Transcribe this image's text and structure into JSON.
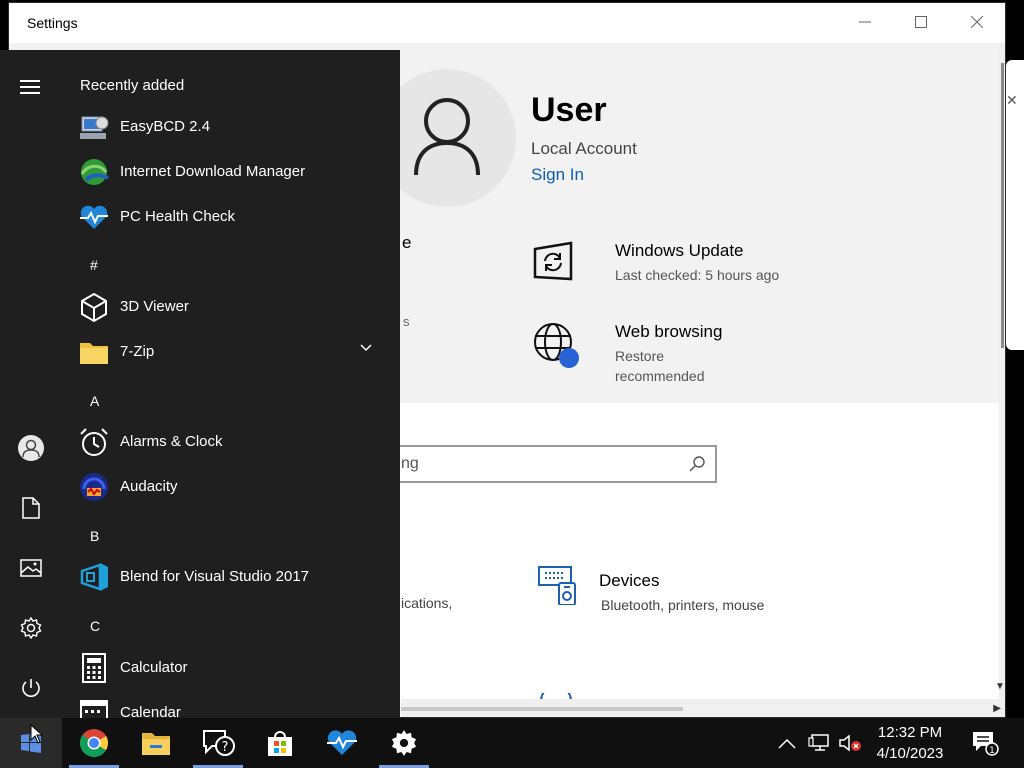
{
  "window": {
    "title": "Settings"
  },
  "user": {
    "name": "User",
    "account_type": "Local Account",
    "sign_in": "Sign In"
  },
  "hero_fragments": {
    "frag_e": "e",
    "frag_s": "s"
  },
  "status": [
    {
      "heading": "Windows Update",
      "sub": "Last checked: 5 hours ago",
      "icon": "windows-update-icon"
    },
    {
      "heading": "Web browsing",
      "sub": "Restore recommended",
      "icon": "globe-icon"
    }
  ],
  "search": {
    "value": "ng"
  },
  "devices": {
    "heading": "Devices",
    "sub": "Bluetooth, printers, mouse",
    "partial_left": "ications,"
  },
  "start_menu": {
    "section_title": "Recently added",
    "recent": [
      {
        "label": "EasyBCD 2.4",
        "icon": "easybcd-icon"
      },
      {
        "label": "Internet Download Manager",
        "icon": "idm-icon"
      },
      {
        "label": "PC Health Check",
        "icon": "pc-health-check-icon"
      }
    ],
    "letters": [
      "#",
      "A",
      "B",
      "C"
    ],
    "apps": [
      {
        "label": "3D Viewer",
        "icon": "cube-icon"
      },
      {
        "label": "7-Zip",
        "icon": "folder-icon"
      },
      {
        "label": "Alarms & Clock",
        "icon": "alarm-clock-icon"
      },
      {
        "label": "Audacity",
        "icon": "audacity-icon"
      },
      {
        "label": "Blend for Visual Studio 2017",
        "icon": "blend-icon"
      },
      {
        "label": "Calculator",
        "icon": "calculator-icon"
      },
      {
        "label": "Calendar",
        "icon": "calendar-icon"
      }
    ]
  },
  "taskbar": {
    "pinned": [
      "windows-start-icon",
      "chrome-icon",
      "file-explorer-icon",
      "get-help-icon",
      "microsoft-store-icon",
      "pc-health-check-icon",
      "settings-gear-icon"
    ],
    "time": "12:32 PM",
    "date": "4/10/2023",
    "notification_count": "1"
  },
  "colors": {
    "accent": "#0a5fb4",
    "start_bg": "#1f1f1f",
    "taskbar_bg": "#101010"
  }
}
